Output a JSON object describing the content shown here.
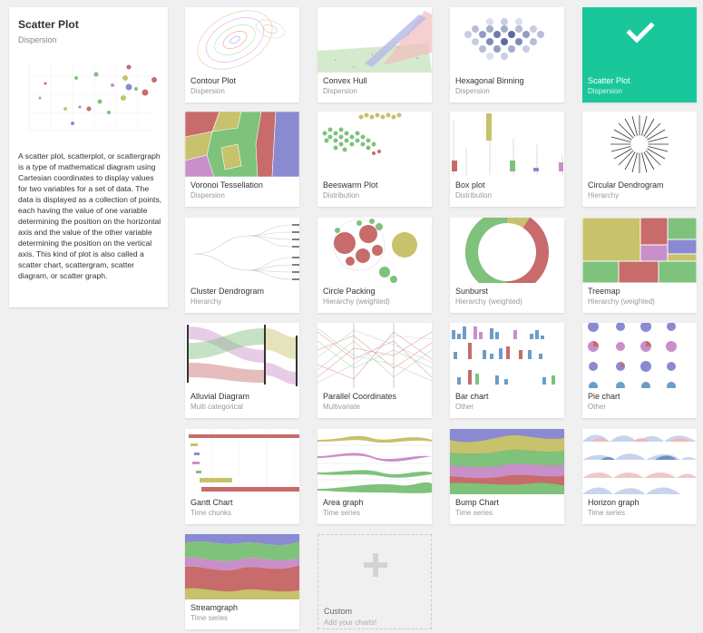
{
  "selected": {
    "title": "Scatter Plot",
    "category": "Dispersion",
    "description": "A scatter plot, scatterplot, or scattergraph is a type of mathematical diagram using Cartesian coordinates to display values for two variables for a set of data. The data is displayed as a collection of points, each having the value of one variable determining the position on the horizontal axis and the value of the other variable determining the position on the vertical axis. This kind of plot is also called a scatter chart, scattergram, scatter diagram, or scatter graph."
  },
  "charts": [
    {
      "name": "Contour Plot",
      "category": "Dispersion"
    },
    {
      "name": "Convex Hull",
      "category": "Dispersion"
    },
    {
      "name": "Hexagonal Binning",
      "category": "Dispersion"
    },
    {
      "name": "Scatter Plot",
      "category": "Dispersion"
    },
    {
      "name": "Voronoi Tessellation",
      "category": "Dispersion"
    },
    {
      "name": "Beeswarm Plot",
      "category": "Distribution"
    },
    {
      "name": "Box plot",
      "category": "Distribution"
    },
    {
      "name": "Circular Dendrogram",
      "category": "Hierarchy"
    },
    {
      "name": "Cluster Dendrogram",
      "category": "Hierarchy"
    },
    {
      "name": "Circle Packing",
      "category": "Hierarchy (weighted)"
    },
    {
      "name": "Sunburst",
      "category": "Hierarchy (weighted)"
    },
    {
      "name": "Treemap",
      "category": "Hierarchy (weighted)"
    },
    {
      "name": "Alluvial Diagram",
      "category": "Multi categorical"
    },
    {
      "name": "Parallel Coordinates",
      "category": "Multivariate"
    },
    {
      "name": "Bar chart",
      "category": "Other"
    },
    {
      "name": "Pie chart",
      "category": "Other"
    },
    {
      "name": "Gantt Chart",
      "category": "Time chunks"
    },
    {
      "name": "Area graph",
      "category": "Time series"
    },
    {
      "name": "Bump Chart",
      "category": "Time series"
    },
    {
      "name": "Horizon graph",
      "category": "Time series"
    },
    {
      "name": "Streamgraph",
      "category": "Time series"
    }
  ],
  "custom": {
    "label": "Custom",
    "sublabel": "Add your charts!"
  },
  "colors": {
    "selected": "#1ac79b",
    "palette": [
      "#c76b6b",
      "#7ec27c",
      "#8a8ad2",
      "#c7c26b",
      "#c98fc9",
      "#6b9ec7"
    ]
  }
}
